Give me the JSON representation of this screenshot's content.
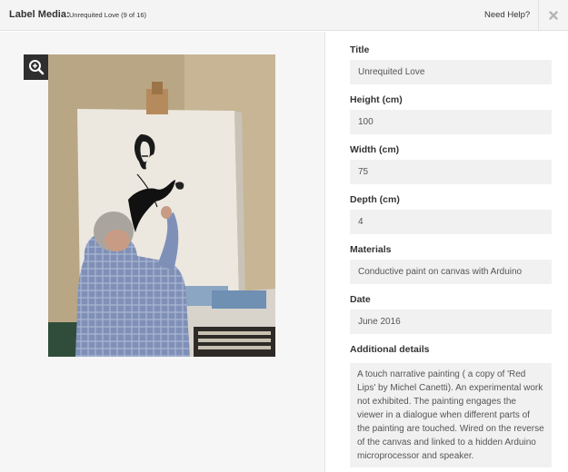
{
  "header": {
    "label": "Label Media:",
    "media_title": "Unrequited Love (9 of 16)",
    "help_label": "Need Help?",
    "close_icon": "close-x-icon"
  },
  "preview": {
    "zoom_icon": "zoom-in-icon",
    "image_alt": "Artist painting a black silhouette face on a white canvas"
  },
  "form": {
    "title": {
      "label": "Title",
      "value": "Unrequited Love"
    },
    "height": {
      "label": "Height (cm)",
      "value": "100"
    },
    "width": {
      "label": "Width (cm)",
      "value": "75"
    },
    "depth": {
      "label": "Depth (cm)",
      "value": "4"
    },
    "materials": {
      "label": "Materials",
      "value": "Conductive paint on canvas with Arduino"
    },
    "date": {
      "label": "Date",
      "value": "June 2016"
    },
    "details": {
      "label": "Additional details",
      "value": "A touch narrative painting ( a copy of 'Red Lips' by Michel Canetti). An experimental work not exhibited. The painting engages the viewer in a dialogue when different parts of the painting are touched. Wired on the reverse of the canvas and linked to a hidden Arduino microprocessor and speaker."
    }
  }
}
